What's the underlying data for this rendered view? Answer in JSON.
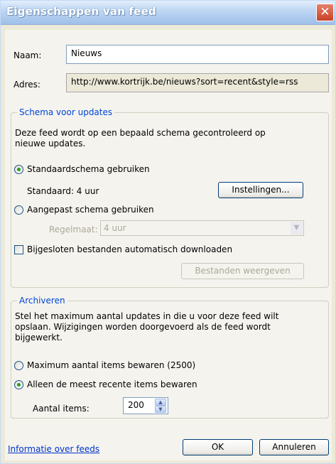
{
  "window": {
    "title": "Eigenschappen van feed"
  },
  "form": {
    "name_label": "Naam:",
    "name_value": "Nieuws",
    "address_label": "Adres:",
    "address_value": "http://www.kortrijk.be/nieuws?sort=recent&style=rss"
  },
  "schedule": {
    "legend": "Schema voor updates",
    "description_line1": "Deze feed wordt op een bepaald schema gecontroleerd op",
    "description_line2": "nieuwe updates.",
    "default_option": "Standaardschema gebruiken",
    "default_option_selected": true,
    "default_text": "Standaard: 4 uur",
    "settings_button": "Instellingen...",
    "custom_option": "Aangepast schema gebruiken",
    "custom_option_selected": false,
    "frequency_label": "Regelmaat:",
    "frequency_value": "4 uur",
    "auto_download_label": "Bijgesloten bestanden automatisch downloaden",
    "auto_download_checked": false,
    "view_files_button": "Bestanden weergeven"
  },
  "archive": {
    "legend": "Archiveren",
    "description_line1": "Stel het maximum aantal updates in die u voor deze feed wilt",
    "description_line2": "opslaan. Wijzigingen worden doorgevoerd als de feed wordt",
    "description_line3": "bijgewerkt.",
    "max_option": "Maximum aantal items bewaren (2500)",
    "max_option_selected": false,
    "recent_option": "Alleen de meest recente items bewaren",
    "recent_option_selected": true,
    "items_label": "Aantal items:",
    "items_value": "200"
  },
  "footer": {
    "info_link": "Informatie over feeds",
    "ok_button": "OK",
    "cancel_button": "Annuleren"
  },
  "icons": {
    "close": "close-icon",
    "dropdown": "chevron-down-icon",
    "spin_up": "arrow-up-icon",
    "spin_down": "arrow-down-icon"
  }
}
